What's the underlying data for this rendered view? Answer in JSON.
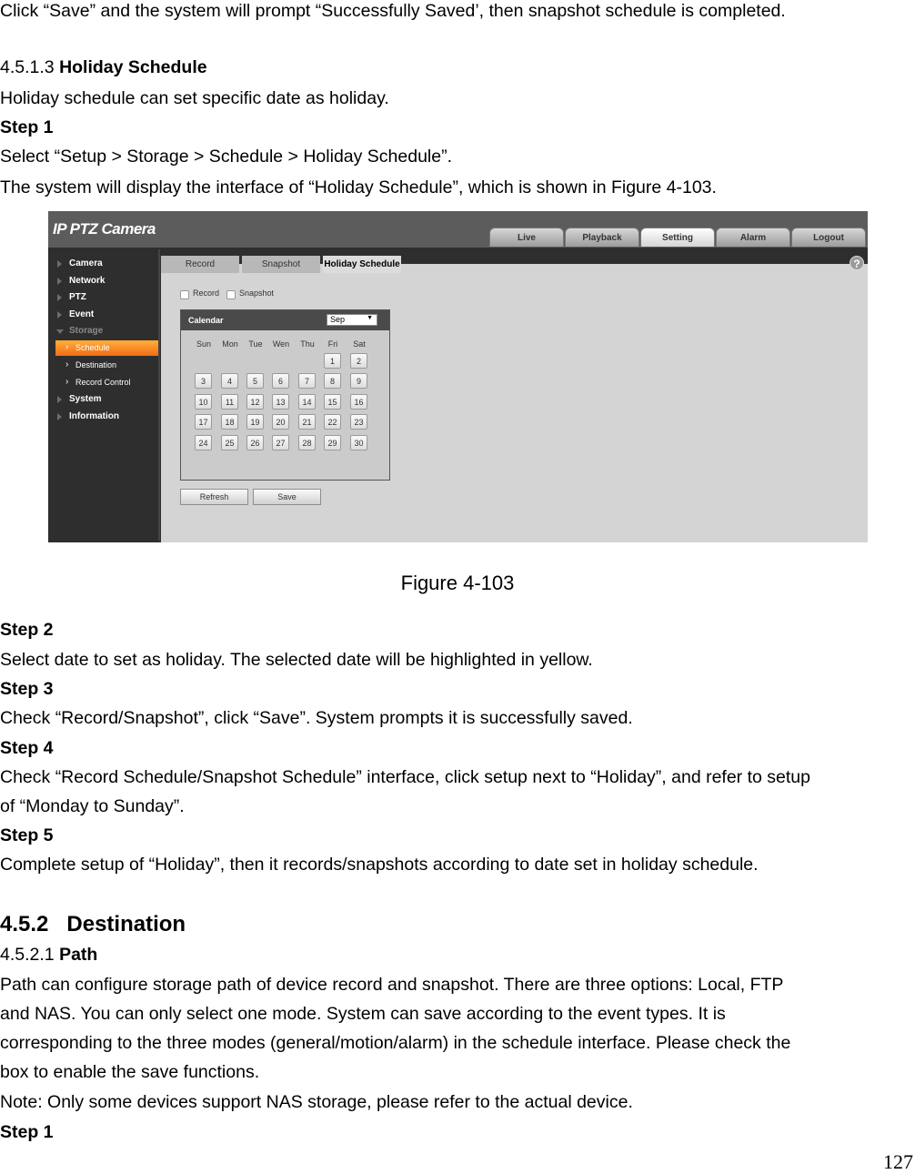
{
  "document": {
    "intro_line": "Click “Save” and the system will prompt “Successfully Saved’, then snapshot schedule is completed.",
    "section_4513": {
      "number": "4.5.1.3",
      "title": "Holiday Schedule"
    },
    "desc": "Holiday schedule can set specific date as holiday.",
    "step1_label": "Step 1",
    "step1_text": "Select “Setup > Storage > Schedule > Holiday Schedule”.",
    "step1_text2": "The system will display the interface of “Holiday Schedule”, which is shown in Figure 4-103.",
    "figure_caption": "Figure 4-103",
    "step2_label": "Step 2",
    "step2_text": "Select date to set as holiday. The selected date will be highlighted in yellow.",
    "step3_label": "Step 3",
    "step3_text": "Check “Record/Snapshot”, click “Save”. System prompts it is successfully saved.",
    "step4_label": "Step 4",
    "step4_text_1": "Check “Record Schedule/Snapshot Schedule” interface, click setup next to “Holiday”, and refer to setup",
    "step4_text_2": "of “Monday to Sunday”.",
    "step5_label": "Step 5",
    "step5_text": "Complete setup of “Holiday”, then it records/snapshots according to date set in holiday schedule.",
    "section_452": {
      "number": "4.5.2",
      "title": "Destination"
    },
    "section_4521": {
      "number": "4.5.2.1",
      "title": "Path"
    },
    "path_para": [
      "Path can configure storage path of device record and snapshot. There are three options: Local, FTP",
      "and NAS. You can only select one mode. System can save according to the event types. It is",
      "corresponding to the three modes (general/motion/alarm) in the schedule interface. Please check the",
      "box to enable the save functions."
    ],
    "note": "Note: Only some devices support NAS storage, please refer to the actual device.",
    "step1b_label": "Step 1",
    "page_number": "127"
  },
  "figure": {
    "app_title": "IP PTZ Camera",
    "nav_tabs": [
      {
        "label": "Live"
      },
      {
        "label": "Playback"
      },
      {
        "label": "Setting",
        "active": true
      },
      {
        "label": "Alarm"
      },
      {
        "label": "Logout"
      }
    ],
    "sidebar": {
      "items": [
        {
          "label": "Camera"
        },
        {
          "label": "Network"
        },
        {
          "label": "PTZ"
        },
        {
          "label": "Event"
        },
        {
          "label": "Storage",
          "expanded": true
        },
        {
          "label": "System"
        },
        {
          "label": "Information"
        }
      ],
      "storage_children": [
        {
          "label": "Schedule",
          "active": true
        },
        {
          "label": "Destination"
        },
        {
          "label": "Record Control"
        }
      ]
    },
    "sub_tabs": [
      {
        "label": "Record"
      },
      {
        "label": "Snapshot"
      },
      {
        "label": "Holiday Schedule",
        "active": true
      }
    ],
    "help_icon": "?",
    "checkboxes": [
      {
        "label": "Record",
        "checked": false
      },
      {
        "label": "Snapshot",
        "checked": false
      }
    ],
    "calendar": {
      "title": "Calendar",
      "month": "Sep",
      "weekdays": [
        "Sun",
        "Mon",
        "Tue",
        "Wen",
        "Thu",
        "Fri",
        "Sat"
      ],
      "days": [
        "1",
        "2",
        "3",
        "4",
        "5",
        "6",
        "7",
        "8",
        "9",
        "10",
        "11",
        "12",
        "13",
        "14",
        "15",
        "16",
        "17",
        "18",
        "19",
        "20",
        "21",
        "22",
        "23",
        "24",
        "25",
        "26",
        "27",
        "28",
        "29",
        "30"
      ],
      "first_weekday_index": 5
    },
    "buttons": {
      "refresh": "Refresh",
      "save": "Save"
    }
  }
}
